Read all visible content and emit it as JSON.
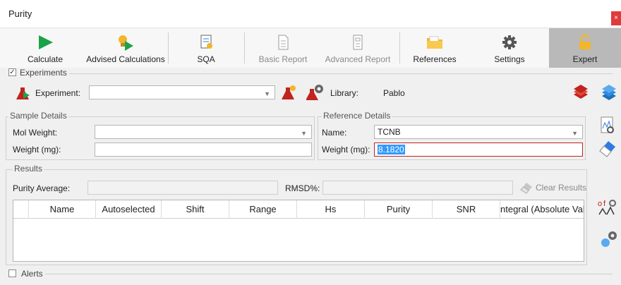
{
  "window": {
    "title": "Purity",
    "close": "×"
  },
  "toolbar": {
    "calculate": "Calculate",
    "advised": "Advised Calculations",
    "sqa": "SQA",
    "basic_report": "Basic Report",
    "advanced_report": "Advanced Report",
    "references": "References",
    "settings": "Settings",
    "expert": "Expert"
  },
  "experiments": {
    "header": "Experiments",
    "checked": true,
    "check_mark": "✓",
    "experiment_label": "Experiment:",
    "experiment_value": "",
    "library_label": "Library:",
    "library_value": "Pablo"
  },
  "sample": {
    "legend": "Sample Details",
    "mol_weight_label": "Mol Weight:",
    "mol_weight_value": "",
    "weight_label": "Weight (mg):",
    "weight_value": ""
  },
  "reference": {
    "legend": "Reference Details",
    "name_label": "Name:",
    "name_value": "TCNB",
    "weight_label": "Weight (mg):",
    "weight_value": "8.1820"
  },
  "results": {
    "legend": "Results",
    "purity_avg_label": "Purity Average:",
    "purity_avg_value": "",
    "rmsd_label": "RMSD%:",
    "rmsd_value": "",
    "clear_label": "Clear Results",
    "columns": [
      "Name",
      "Autoselected",
      "Shift",
      "Range",
      "Hs",
      "Purity",
      "SNR",
      "ntegral (Absolute Value"
    ]
  },
  "alerts": {
    "header": "Alerts",
    "checked": false
  },
  "colors": {
    "accent_green": "#1aa34a",
    "red_flask": "#c0241c",
    "expert_bg": "#b9b9b9",
    "selection": "#3399ff"
  },
  "icons": [
    "play-icon",
    "advised-calc-icon",
    "sqa-icon",
    "basic-report-icon",
    "advanced-report-icon",
    "folder-icon",
    "gear-icon",
    "lock-icon"
  ]
}
